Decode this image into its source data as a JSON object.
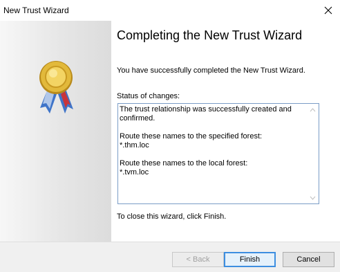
{
  "window": {
    "title": "New Trust Wizard"
  },
  "heading": "Completing the New Trust Wizard",
  "intro": "You have successfully completed the New Trust Wizard.",
  "status": {
    "label": "Status of changes:",
    "lines": [
      "The trust relationship was successfully created and confirmed.",
      "",
      "Route these names to the specified forest:",
      "*.thm.loc",
      "",
      "Route these names to the local forest:",
      "*.tvm.loc"
    ]
  },
  "footnote": "To close this wizard, click Finish.",
  "buttons": {
    "back": "< Back",
    "finish": "Finish",
    "cancel": "Cancel"
  },
  "colors": {
    "accent": "#3d8ee0",
    "box_border": "#7a9cc6",
    "medal_gold": "#e2b93b",
    "ribbon_blue": "#3e74c9",
    "ribbon_red": "#c8353b"
  }
}
